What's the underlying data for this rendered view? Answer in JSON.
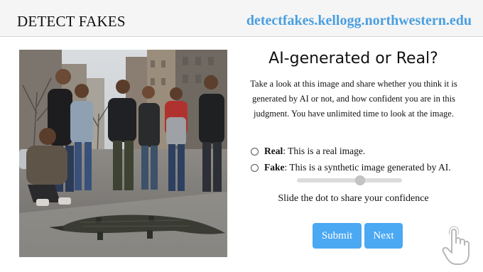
{
  "header": {
    "brand": "DETECT FAKES",
    "site_url": "detectfakes.kellogg.northwestern.edu"
  },
  "image": {
    "description_icon": "photo-scene"
  },
  "main": {
    "title": "AI-generated or Real?",
    "description": "Take a look at this image and share whether you think it is generated by AI or not, and how confident you are in this judgment. You have unlimited time to look at the image.",
    "options": [
      {
        "key": "Real",
        "text": ": This is a real image."
      },
      {
        "key": "Fake",
        "text": ": This is a synthetic image generated by AI."
      }
    ],
    "confidence_level": 0.6,
    "slider_hint": "Slide the dot to share your confidence",
    "submit_label": "Submit",
    "next_label": "Next"
  },
  "colors": {
    "accent": "#4ba8f2",
    "link": "#4a9fe0"
  }
}
